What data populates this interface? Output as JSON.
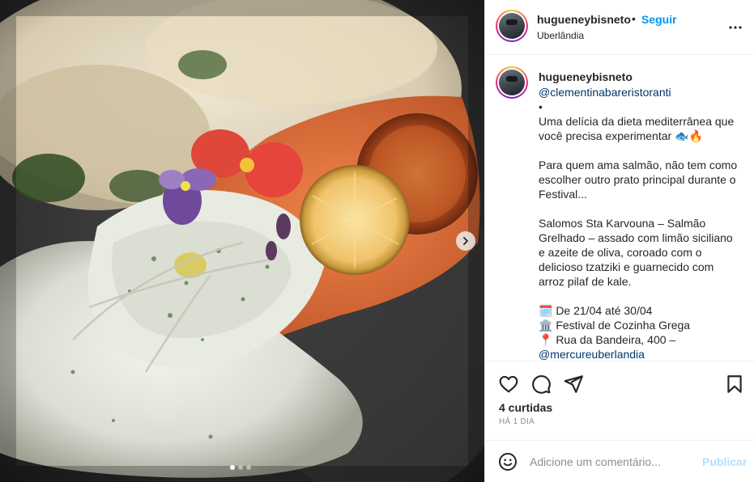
{
  "post": {
    "username": "hugueneybisneto",
    "follow_label": "Seguir",
    "separator": "•",
    "location": "Uberlândia"
  },
  "caption": {
    "username": "hugueneybisneto",
    "mention": "@clementinabareristoranti",
    "bullet": "•",
    "line1": "Uma delícia da dieta mediterrânea que você precisa experimentar 🐟🔥",
    "para2": "Para quem ama salmão, não tem como escolher outro prato principal durante o Festival...",
    "para3": "Salomos Sta Karvouna – Salmão Grelhado – assado com limão siciliano e azeite de oliva, coroado com o delicioso tzatziki e guarnecido com arroz pilaf de kale.",
    "date_line": "🗓️ De 21/04 até 30/04",
    "venue_line": "🏛️ Festival de Cozinha Grega",
    "address_line": "📍 Rua da Bandeira, 400 –",
    "mention2": "@mercureuberlandia"
  },
  "stats": {
    "likes": "4 curtidas",
    "time_ago": "HÁ 1 DIA"
  },
  "comment": {
    "placeholder": "Adicione um comentário...",
    "post_label": "Publicar"
  },
  "carousel": {
    "current_slide": 1,
    "total_slides": 3
  },
  "icons": {
    "more": "more-options-icon",
    "like": "heart-icon",
    "comment": "comment-icon",
    "share": "paper-plane-icon",
    "save": "bookmark-icon",
    "emoji": "smiley-icon",
    "next": "chevron-right-icon"
  },
  "colors": {
    "link": "#0095f6",
    "mention": "#00376b",
    "muted": "#8e8e8e",
    "post_disabled": "#b2dffc"
  }
}
